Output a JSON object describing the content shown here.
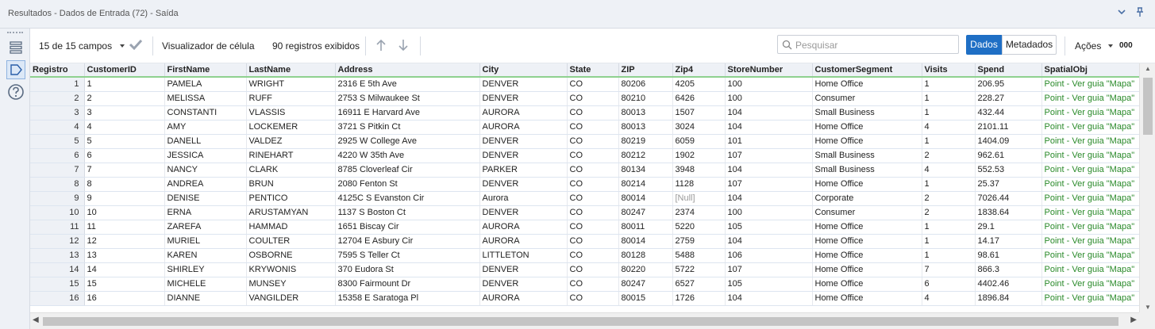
{
  "window": {
    "title": "Resultados - Dados de Entrada (72) - Saída"
  },
  "toolbar": {
    "fields_label": "15 de 15 campos",
    "cell_viewer_label": "Visualizador de célula",
    "records_label": "90 registros exibidos",
    "search_placeholder": "Pesquisar",
    "dados_label": "Dados",
    "metadados_label": "Metadados",
    "acoes_label": "Ações",
    "more_label": "000"
  },
  "grid": {
    "columns": [
      "Registro",
      "CustomerID",
      "FirstName",
      "LastName",
      "Address",
      "City",
      "State",
      "ZIP",
      "Zip4",
      "StoreNumber",
      "CustomerSegment",
      "Visits",
      "Spend",
      "SpatialObj"
    ],
    "rows": [
      [
        "1",
        "1",
        "PAMELA",
        "WRIGHT",
        "2316 E 5th Ave",
        "DENVER",
        "CO",
        "80206",
        "4205",
        "100",
        "Home Office",
        "1",
        "206.95",
        "Point - Ver guia \"Mapa\""
      ],
      [
        "2",
        "2",
        "MELISSA",
        "RUFF",
        "2753 S Milwaukee St",
        "DENVER",
        "CO",
        "80210",
        "6426",
        "100",
        "Consumer",
        "1",
        "228.27",
        "Point - Ver guia \"Mapa\""
      ],
      [
        "3",
        "3",
        "CONSTANTI",
        "VLASSIS",
        "16911 E Harvard Ave",
        "AURORA",
        "CO",
        "80013",
        "1507",
        "104",
        "Small Business",
        "1",
        "432.44",
        "Point - Ver guia \"Mapa\""
      ],
      [
        "4",
        "4",
        "AMY",
        "LOCKEMER",
        "3721 S Pitkin Ct",
        "AURORA",
        "CO",
        "80013",
        "3024",
        "104",
        "Home Office",
        "4",
        "2101.11",
        "Point - Ver guia \"Mapa\""
      ],
      [
        "5",
        "5",
        "DANELL",
        "VALDEZ",
        "2925 W College Ave",
        "DENVER",
        "CO",
        "80219",
        "6059",
        "101",
        "Home Office",
        "1",
        "1404.09",
        "Point - Ver guia \"Mapa\""
      ],
      [
        "6",
        "6",
        "JESSICA",
        "RINEHART",
        "4220 W 35th Ave",
        "DENVER",
        "CO",
        "80212",
        "1902",
        "107",
        "Small Business",
        "2",
        "962.61",
        "Point - Ver guia \"Mapa\""
      ],
      [
        "7",
        "7",
        "NANCY",
        "CLARK",
        "8785 Cloverleaf Cir",
        "PARKER",
        "CO",
        "80134",
        "3948",
        "104",
        "Small Business",
        "4",
        "552.53",
        "Point - Ver guia \"Mapa\""
      ],
      [
        "8",
        "8",
        "ANDREA",
        "BRUN",
        "2080 Fenton St",
        "DENVER",
        "CO",
        "80214",
        "1128",
        "107",
        "Home Office",
        "1",
        "25.37",
        "Point - Ver guia \"Mapa\""
      ],
      [
        "9",
        "9",
        "DENISE",
        "PENTICO",
        "4125C S Evanston Cir",
        "Aurora",
        "CO",
        "80014",
        "[Null]",
        "104",
        "Corporate",
        "2",
        "7026.44",
        "Point - Ver guia \"Mapa\""
      ],
      [
        "10",
        "10",
        "ERNA",
        "ARUSTAMYAN",
        "1137 S Boston Ct",
        "DENVER",
        "CO",
        "80247",
        "2374",
        "100",
        "Consumer",
        "2",
        "1838.64",
        "Point - Ver guia \"Mapa\""
      ],
      [
        "11",
        "11",
        "ZAREFA",
        "HAMMAD",
        "1651 Biscay Cir",
        "AURORA",
        "CO",
        "80011",
        "5220",
        "105",
        "Home Office",
        "1",
        "29.1",
        "Point - Ver guia \"Mapa\""
      ],
      [
        "12",
        "12",
        "MURIEL",
        "COULTER",
        "12704 E Asbury Cir",
        "AURORA",
        "CO",
        "80014",
        "2759",
        "104",
        "Home Office",
        "1",
        "14.17",
        "Point - Ver guia \"Mapa\""
      ],
      [
        "13",
        "13",
        "KAREN",
        "OSBORNE",
        "7595 S Teller Ct",
        "LITTLETON",
        "CO",
        "80128",
        "5488",
        "106",
        "Home Office",
        "1",
        "98.61",
        "Point - Ver guia \"Mapa\""
      ],
      [
        "14",
        "14",
        "SHIRLEY",
        "KRYWONIS",
        "370 Eudora St",
        "DENVER",
        "CO",
        "80220",
        "5722",
        "107",
        "Home Office",
        "7",
        "866.3",
        "Point - Ver guia \"Mapa\""
      ],
      [
        "15",
        "15",
        "MICHELE",
        "MUNSEY",
        "8300 Fairmount Dr",
        "DENVER",
        "CO",
        "80247",
        "6527",
        "105",
        "Home Office",
        "6",
        "4402.46",
        "Point - Ver guia \"Mapa\""
      ],
      [
        "16",
        "16",
        "DIANNE",
        "VANGILDER",
        "15358 E Saratoga Pl",
        "AURORA",
        "CO",
        "80015",
        "1726",
        "104",
        "Home Office",
        "4",
        "1896.84",
        "Point - Ver guia \"Mapa\""
      ]
    ]
  },
  "icons": {
    "collapse": "chevron-down-icon",
    "pin": "pin-icon",
    "search": "search-icon"
  },
  "colors": {
    "accent": "#1f6fc5",
    "spatial_text": "#2a8a2a",
    "header_underline": "#8fd18f"
  }
}
